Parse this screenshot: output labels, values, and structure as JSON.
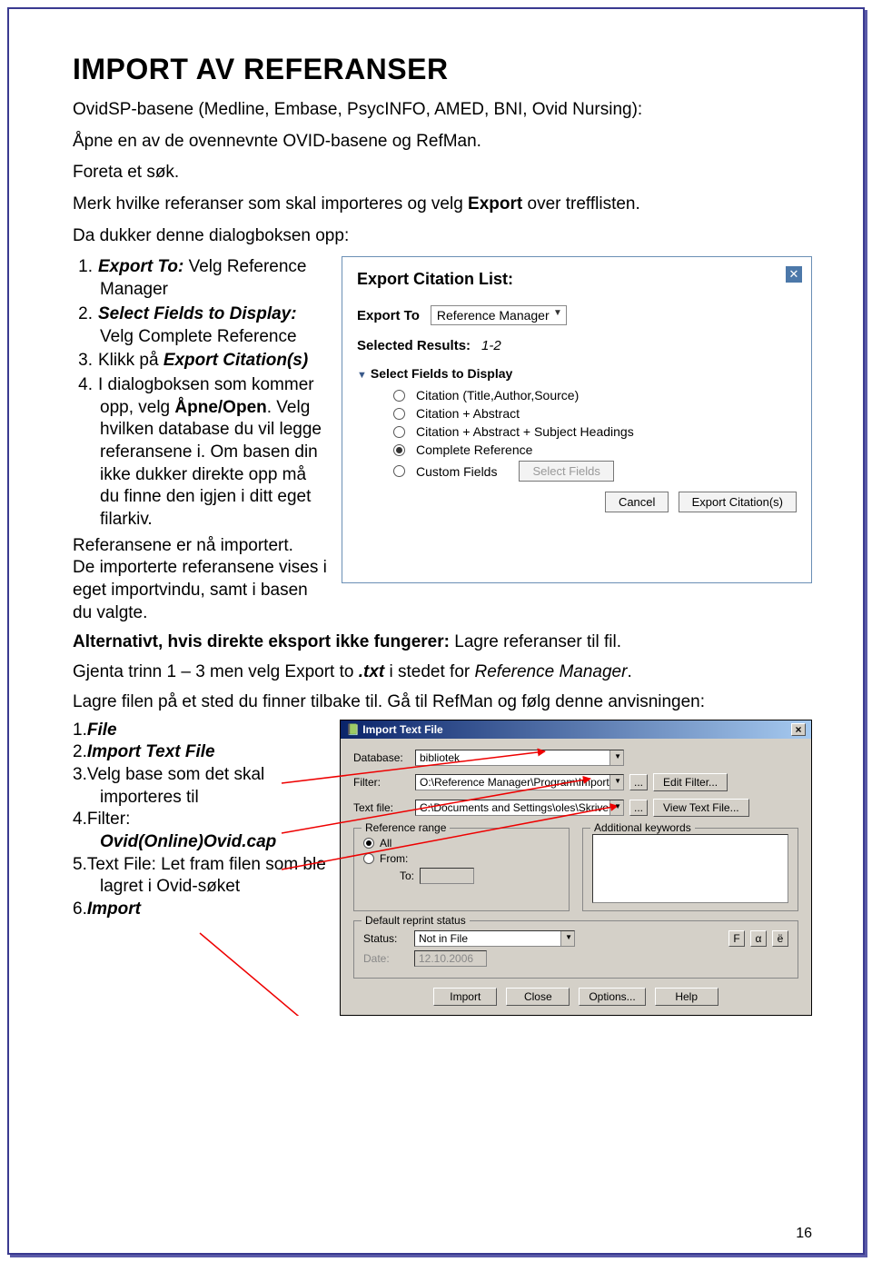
{
  "page_number": "16",
  "heading": "IMPORT AV REFERANSER",
  "para1": "OvidSP-basene (Medline, Embase, PsycINFO, AMED, BNI, Ovid Nursing):",
  "para2a": "Åpne en av de ovennevnte OVID-basene og RefMan.",
  "para2b": "Foreta et søk.",
  "para2c_a": "Merk hvilke referanser som skal importeres og velg ",
  "para2c_b": "Export ",
  "para2c_c": "over trefflisten.",
  "para2d": "Da dukker denne dialogboksen opp:",
  "list1": {
    "n1": "1.",
    "t1a": "Export To:",
    "t1b": " Velg Reference Manager",
    "n2": "2.",
    "t2a": "Select Fields to Display:",
    "t2b": " Velg Complete Reference",
    "n3": "3.",
    "t3a": "Klikk på ",
    "t3b": "Export Citation(s)",
    "n4": "4.",
    "t4a": "I dialogboksen som kommer opp, velg ",
    "t4b": "Åpne/Open",
    "t4c": ". Velg hvilken database du vil legge referansene i. Om basen din ikke dukker direkte opp må du finne den igjen i ditt eget filarkiv.",
    "after1": "Referansene er nå importert.",
    "after2": "De importerte referansene vises i eget importvindu, samt i basen du valgte."
  },
  "ovid": {
    "title": "Export Citation List:",
    "export_to_label": "Export To",
    "export_to_value": "Reference Manager",
    "selected_label": "Selected Results:",
    "selected_value": "1-2",
    "fields_label": "Select Fields to Display",
    "options": [
      "Citation (Title,Author,Source)",
      "Citation + Abstract",
      "Citation + Abstract + Subject Headings",
      "Complete Reference",
      "Custom Fields"
    ],
    "select_fields_btn": "Select Fields",
    "cancel": "Cancel",
    "export_btn": "Export Citation(s)"
  },
  "alt_heading_a": "Alternativt, hvis direkte eksport ikke fungerer:",
  "alt_heading_b": " Lagre referanser til fil.",
  "alt_line2_a": "Gjenta trinn 1 – 3 men velg Export to ",
  "alt_line2_b": ".txt",
  "alt_line2_c": " i stedet for ",
  "alt_line2_d": "Reference Manager",
  "alt_line2_e": ".",
  "alt_line3": "Lagre filen på et sted du finner tilbake til. Gå til RefMan og følg denne anvisningen:",
  "list2": {
    "n1": "1.",
    "t1": "File",
    "n2": "2.",
    "t2": "Import Text File",
    "n3": "3.",
    "t3": "Velg base som det skal importeres til",
    "n4": "4.",
    "t4a": "Filter:",
    "t4b": "Ovid(Online)Ovid.cap",
    "n5": "5.",
    "t5": "Text File: Let fram filen som ble lagret i Ovid-søket",
    "n6": "6.",
    "t6": "Import"
  },
  "win": {
    "title": "Import Text File",
    "database_label": "Database:",
    "database_value": "bibliotek",
    "filter_label": "Filter:",
    "filter_value": "O:\\Reference Manager\\Program\\Import\\",
    "editfilter": "Edit Filter...",
    "textfile_label": "Text file:",
    "textfile_value": "C:\\Documents and Settings\\oles\\Skriveb",
    "viewtext": "View Text File...",
    "ref_range": "Reference range",
    "all": "All",
    "from": "From:",
    "to": "To:",
    "add_kw": "Additional keywords",
    "default_status": "Default reprint status",
    "status_label": "Status:",
    "status_value": "Not in File",
    "date_label": "Date:",
    "date_value": "12.10.2006",
    "f": "F",
    "alpha": "α",
    "e": "ë",
    "import": "Import",
    "close": "Close",
    "options": "Options...",
    "help": "Help"
  }
}
